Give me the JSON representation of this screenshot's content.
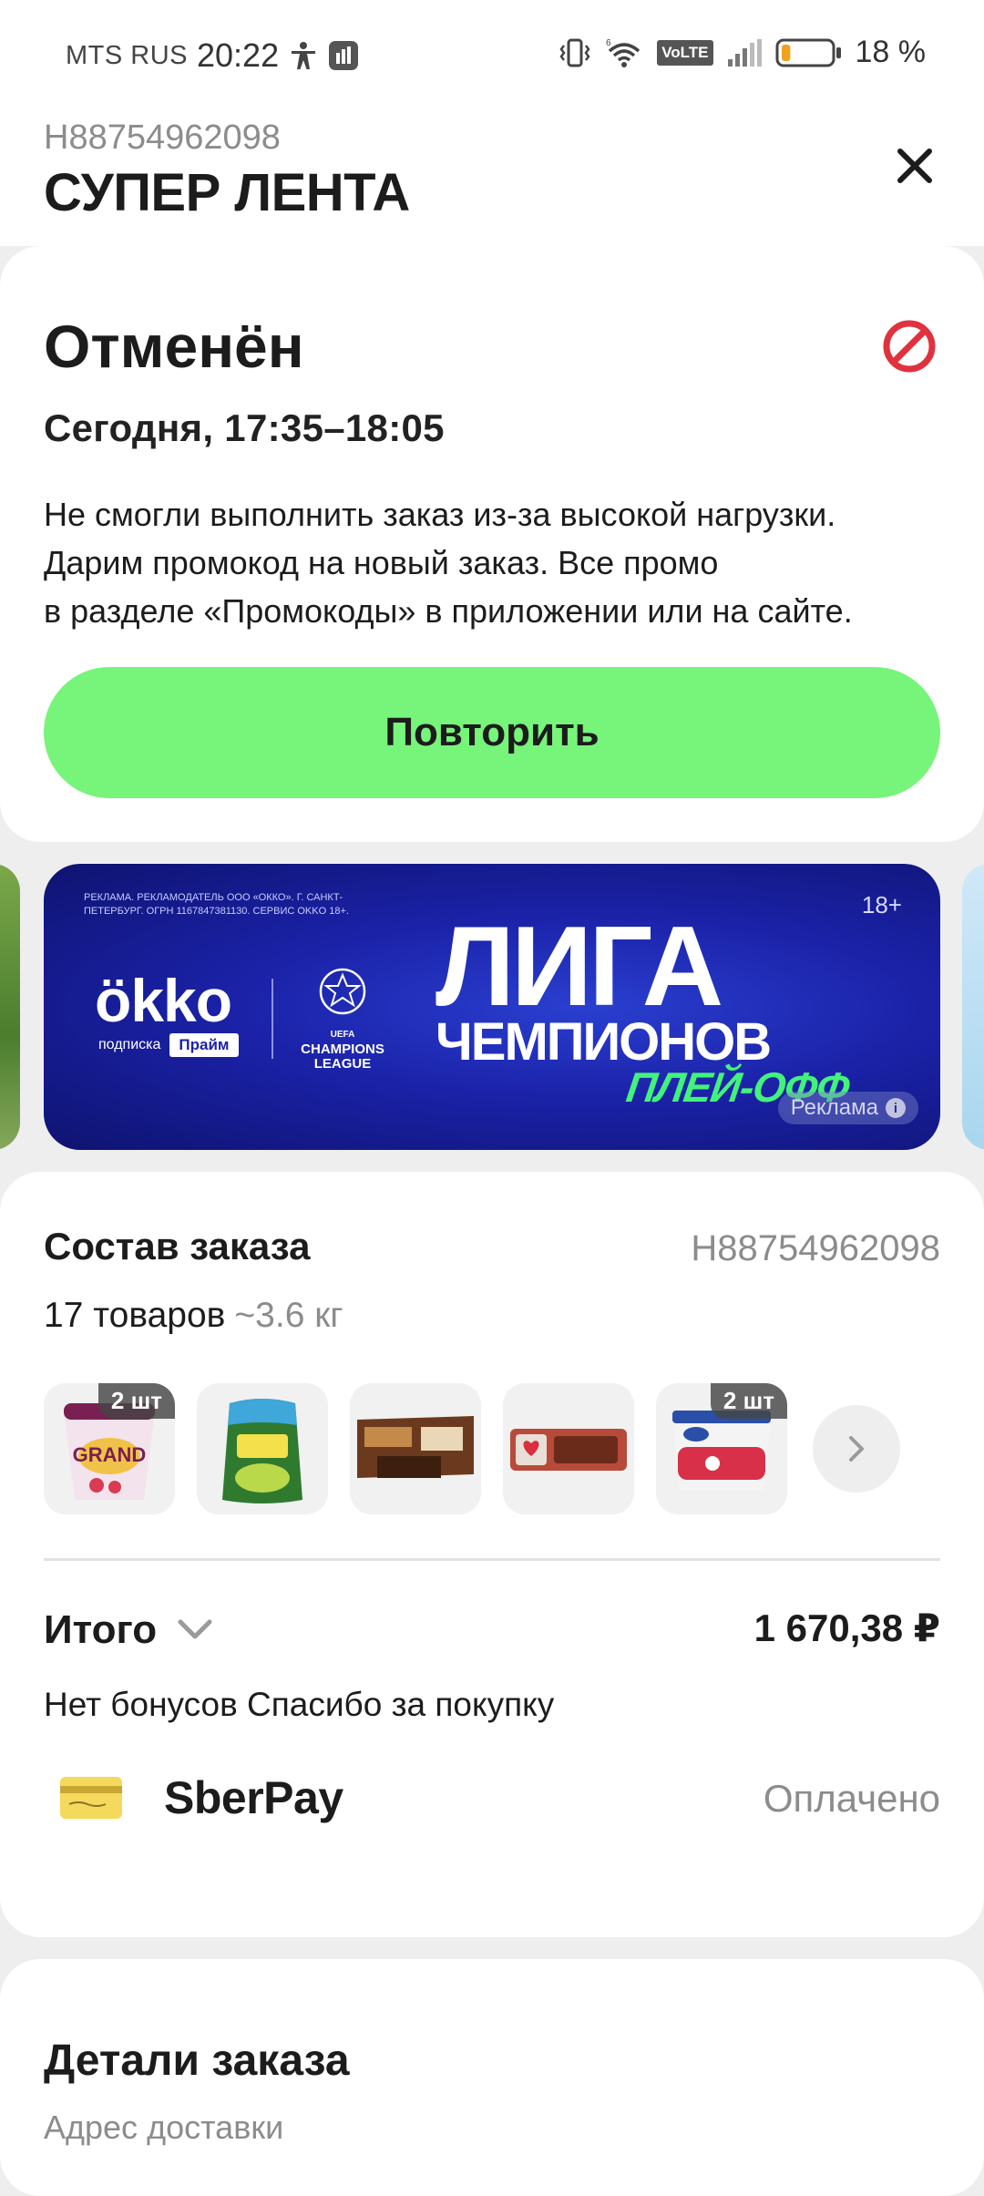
{
  "status_bar": {
    "carrier": "MTS RUS",
    "time": "20:22",
    "network_badge": "VoLTE",
    "battery": "18 %",
    "battery_level": 0.18,
    "icons": [
      "accessibility-icon",
      "app-notification-icon",
      "vibrate-icon",
      "wifi-icon",
      "signal-icon",
      "battery-icon"
    ]
  },
  "header": {
    "order_id": "H88754962098",
    "store_name": "СУПЕР ЛЕНТА",
    "close_icon": "close-icon"
  },
  "status_card": {
    "title": "Отменён",
    "time": "Сегодня, 17:35–18:05",
    "message_lines": [
      "Не смогли выполнить заказ из-за высокой нагрузки.",
      "Дарим промокод на новый заказ. Все промо",
      "в разделе «Промокоды» в приложении или на сайте."
    ],
    "repeat_button": "Повторить",
    "status_icon": "cancel-icon",
    "status_color": "#e0323e",
    "button_color": "#77f47a"
  },
  "banner": {
    "disclaimer": "Реклама. Рекламодатель ООО «Окко». г. Санкт-Петербург. ОГРН 1167847381130. Сервис Okko 18+.",
    "age": "18+",
    "brand": "ökko",
    "brand_sub": "подписка",
    "brand_plan": "Прайм",
    "partner": "CHAMPIONS LEAGUE",
    "partner_sub": "UEFA",
    "headline_1": "ЛИГА",
    "headline_2": "ЧЕМПИОНОВ",
    "headline_3": "ПЛЕЙ-ОФФ",
    "ad_label": "Реклама"
  },
  "order": {
    "title": "Состав заказа",
    "id": "H88754962098",
    "count": "17 товаров",
    "weight": "~3.6 кг",
    "items": [
      {
        "name": "dessert-cup",
        "qty": "2 шт"
      },
      {
        "name": "milk-pack",
        "qty": ""
      },
      {
        "name": "chocolate-wafers",
        "qty": ""
      },
      {
        "name": "biscuits-pack",
        "qty": ""
      },
      {
        "name": "cottage-cheese-dessert",
        "qty": "2 шт"
      }
    ],
    "total_label": "Итого",
    "total_value": "1 670,38 ₽",
    "bonus_text": "Нет бонусов Спасибо за покупку",
    "payment_method": "SberPay",
    "payment_status": "Оплачено"
  },
  "details": {
    "title": "Детали заказа",
    "subtitle": "Адрес доставки"
  }
}
